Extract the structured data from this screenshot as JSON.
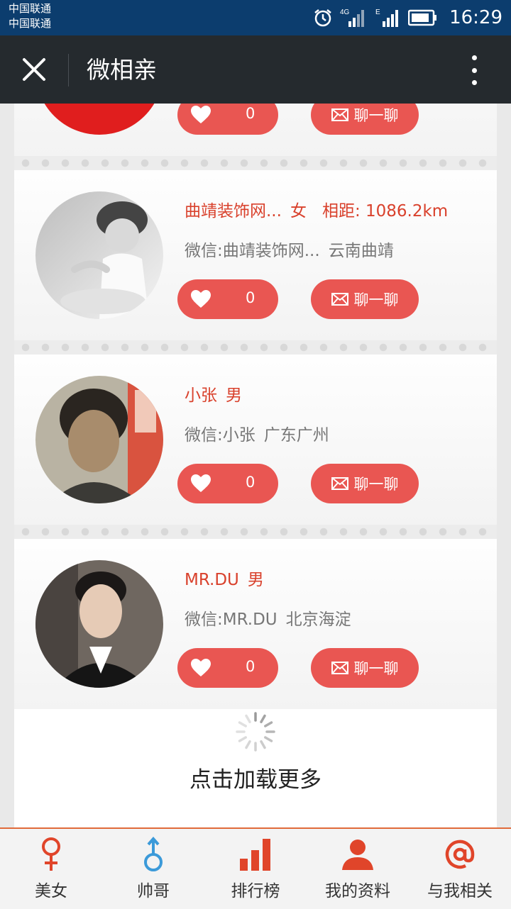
{
  "status_bar": {
    "carrier_1": "中国联通",
    "carrier_2": "中国联通",
    "net_1": "4G",
    "net_2": "E",
    "time": "16:29",
    "icons": [
      "alarm-icon",
      "signal-icon",
      "battery-icon"
    ]
  },
  "header": {
    "title": "微相亲",
    "close_icon": "close-icon",
    "more_icon": "more-vertical-icon"
  },
  "profiles": [
    {
      "name": "",
      "gender": "",
      "distance": "",
      "wechat": "",
      "location": "",
      "likes": "0",
      "chat_label": "聊一聊"
    },
    {
      "name": "曲靖装饰网...",
      "gender": "女",
      "distance": "相距: 1086.2km",
      "wechat": "微信:曲靖装饰网...",
      "location": "云南曲靖",
      "likes": "0",
      "chat_label": "聊一聊"
    },
    {
      "name": "小张",
      "gender": "男",
      "distance": "",
      "wechat": "微信:小张",
      "location": "广东广州",
      "likes": "0",
      "chat_label": "聊一聊"
    },
    {
      "name": "MR.DU",
      "gender": "男",
      "distance": "",
      "wechat": "微信:MR.DU",
      "location": "北京海淀",
      "likes": "0",
      "chat_label": "聊一聊"
    }
  ],
  "load_more": "点击加载更多",
  "bottom_nav": [
    {
      "label": "美女",
      "icon": "female-icon"
    },
    {
      "label": "帅哥",
      "icon": "male-icon"
    },
    {
      "label": "排行榜",
      "icon": "bar-chart-icon"
    },
    {
      "label": "我的资料",
      "icon": "user-icon"
    },
    {
      "label": "与我相关",
      "icon": "at-icon"
    }
  ],
  "colors": {
    "status_bar": "#0c3d6e",
    "title_bar": "#252a2e",
    "accent_red": "#d9412c",
    "button_red": "#e95652",
    "nav_icon": "#e0452a",
    "male_icon": "#3b9ad9"
  }
}
